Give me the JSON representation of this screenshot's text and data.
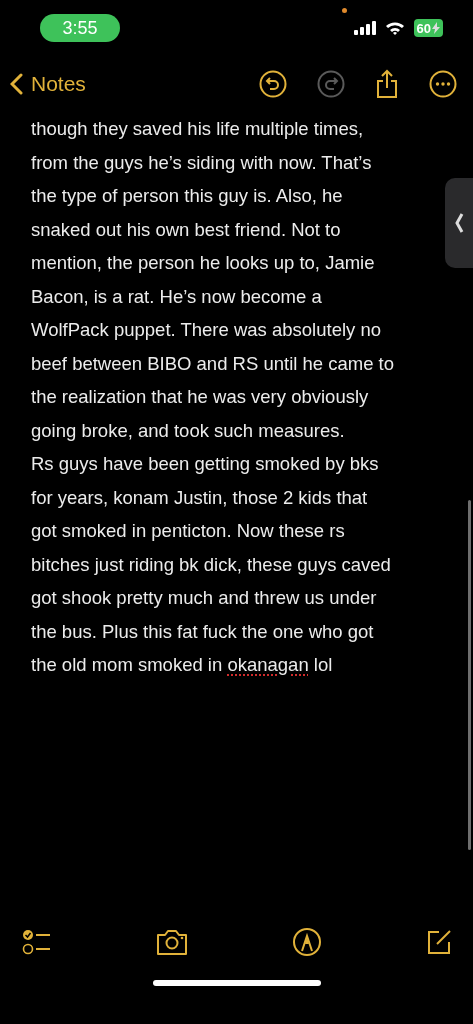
{
  "status_bar": {
    "time": "3:55",
    "battery": "60",
    "charging": true
  },
  "nav": {
    "back_label": "Notes",
    "undo": {
      "disabled": false
    },
    "redo": {
      "disabled": true
    }
  },
  "note": {
    "lines": [
      {
        "text": "though they saved his life multiple times,"
      },
      {
        "text": "from the guys he’s siding with now. That’s"
      },
      {
        "text": "the type of person this guy is. Also, he"
      },
      {
        "text": "snaked out his own best friend. Not to"
      },
      {
        "text": "mention, the person he looks up to, Jamie"
      },
      {
        "text": "Bacon, is a rat. He’s now become a"
      },
      {
        "text": "WolfPack puppet. There was absolutely no"
      },
      {
        "text": "beef between BIBO and RS until he came to"
      },
      {
        "text": "the realization that he was very obviously"
      },
      {
        "text": "going broke, and took such measures."
      },
      {
        "text": "Rs guys have been getting smoked by bks"
      },
      {
        "text": "for years, konam Justin, those 2 kids that"
      },
      {
        "text": "got smoked in penticton. Now these rs"
      },
      {
        "text": "bitches just riding bk dick, these guys caved"
      },
      {
        "text": "got shook pretty much and threw us under"
      },
      {
        "text": "the bus. Plus this fat fuck the one who got"
      },
      {
        "text": "the old mom smoked in",
        "misspelled": "okanagan",
        "rest": "lol"
      }
    ]
  }
}
